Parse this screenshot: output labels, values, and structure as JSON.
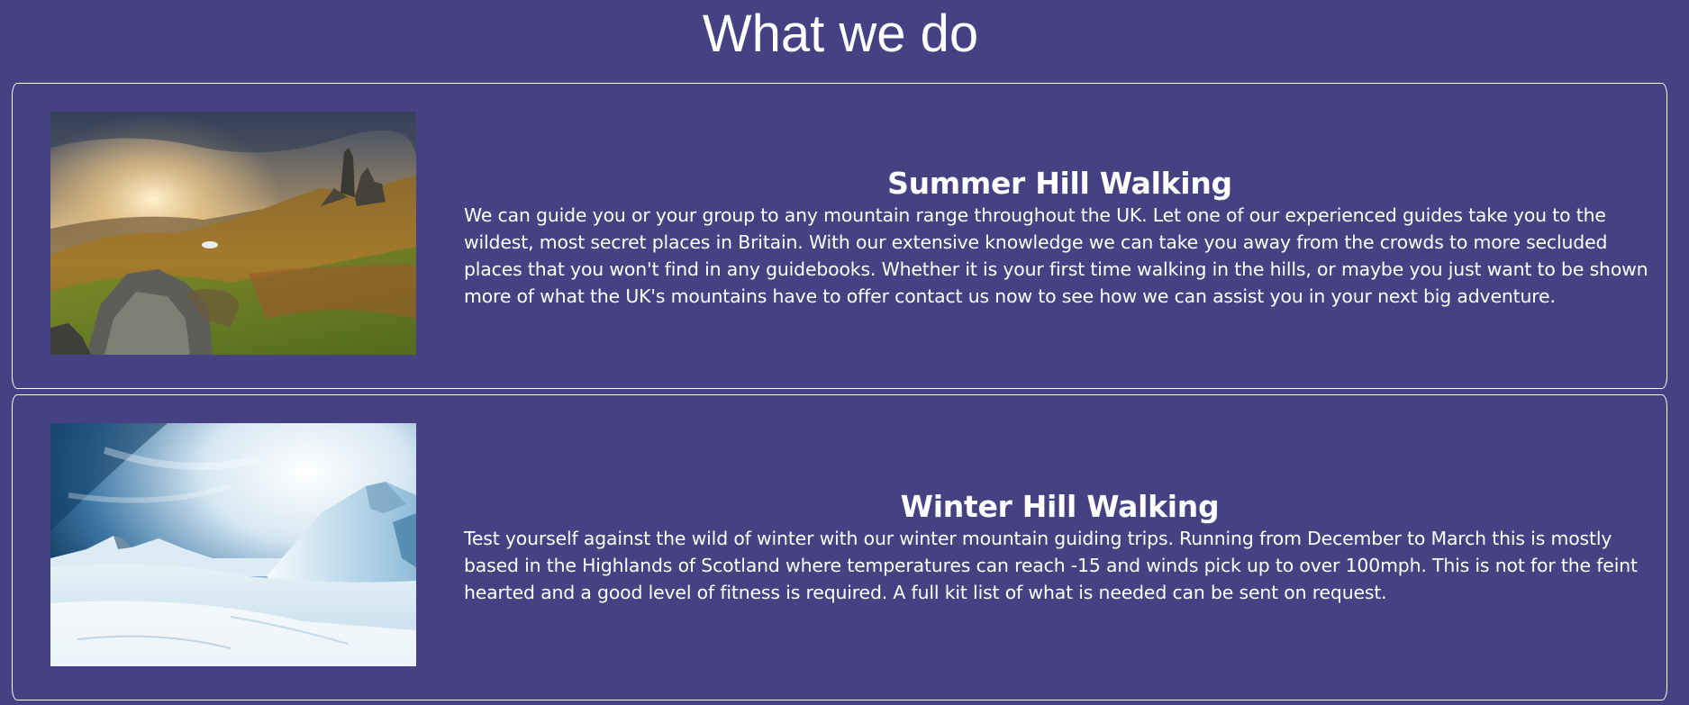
{
  "page": {
    "title": "What we do",
    "background_color": "#454183",
    "text_color": "#ffffff"
  },
  "services": [
    {
      "heading": "Summer Hill Walking",
      "body": "We can guide you or your group to any mountain range throughout the UK. Let one of our experienced guides take you to the wildest, most secret places in Britain. With our extensive knowledge we can take you away from the crowds to more secluded places that you won't find in any guidebooks. Whether it is your first time walking in the hills, or maybe you just want to be shown more of what the UK's mountains have to offer contact us now to see how we can assist you in your next big adventure.",
      "image": "summer-mountain-landscape-photo"
    },
    {
      "heading": "Winter Hill Walking",
      "body": "Test yourself against the wild of winter with our winter mountain guiding trips. Running from December to March this is mostly based in the Highlands of Scotland where temperatures can reach -15 and winds pick up to over 100mph. This is not for the feint hearted and a good level of fitness is required. A full kit list of what is needed can be sent on request.",
      "image": "winter-snowy-mountain-photo"
    }
  ]
}
